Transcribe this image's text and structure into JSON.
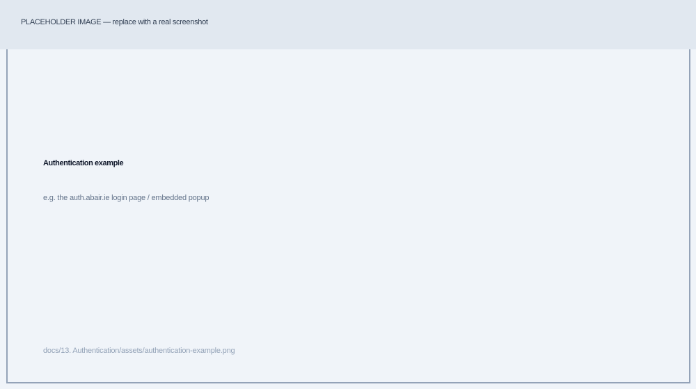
{
  "banner": {
    "text": "PLACEHOLDER IMAGE — replace with a real screenshot"
  },
  "placeholder": {
    "title": "Authentication example",
    "description": "e.g. the auth.abair.ie login page / embedded popup",
    "path": "docs/13. Authentication/assets/authentication-example.png"
  }
}
